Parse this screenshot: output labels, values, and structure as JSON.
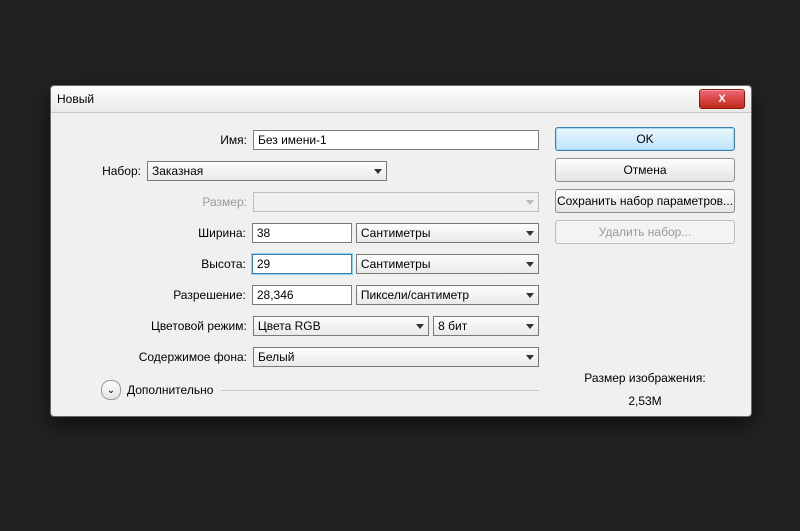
{
  "dialog": {
    "title": "Новый"
  },
  "labels": {
    "name": "Имя:",
    "preset": "Набор:",
    "size": "Размер:",
    "width": "Ширина:",
    "height": "Высота:",
    "resolution": "Разрешение:",
    "colorMode": "Цветовой режим:",
    "background": "Содержимое фона:",
    "advanced": "Дополнительно",
    "imageSizeLabel": "Размер изображения:"
  },
  "values": {
    "name": "Без имени-1",
    "preset": "Заказная",
    "size": "",
    "width": "38",
    "widthUnit": "Сантиметры",
    "height": "29",
    "heightUnit": "Сантиметры",
    "resolution": "28,346",
    "resolutionUnit": "Пиксели/сантиметр",
    "colorMode": "Цвета RGB",
    "bitDepth": "8 бит",
    "background": "Белый",
    "imageSize": "2,53M"
  },
  "buttons": {
    "ok": "OK",
    "cancel": "Отмена",
    "savePreset": "Сохранить набор параметров...",
    "deletePreset": "Удалить набор...",
    "close": "X"
  }
}
